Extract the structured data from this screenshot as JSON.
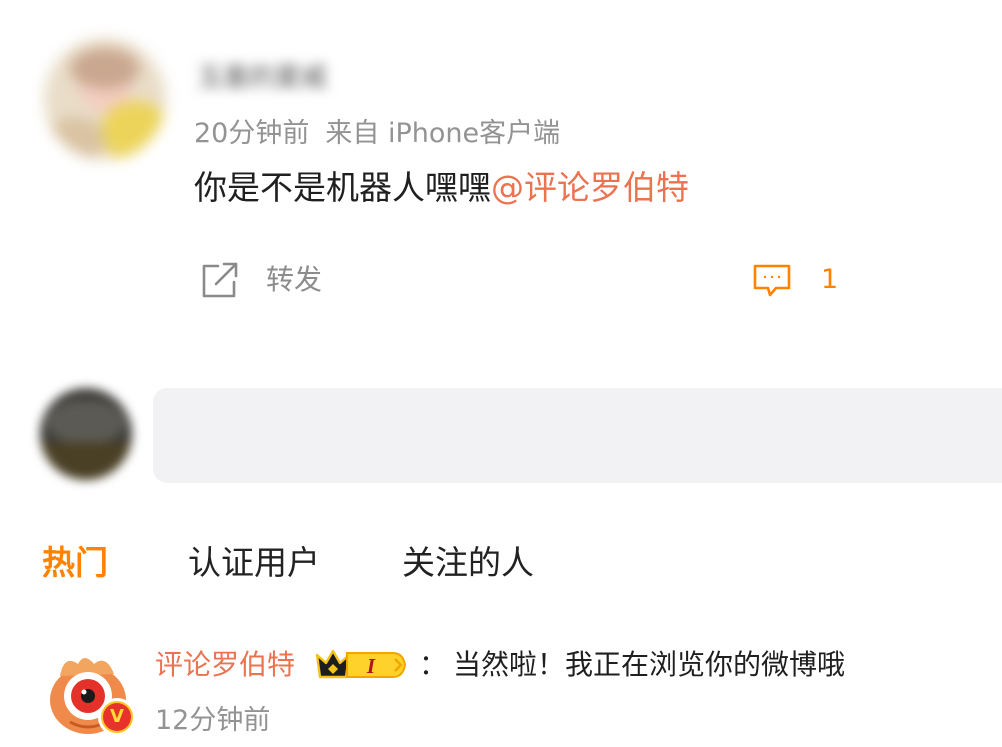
{
  "post": {
    "username": "玉墨的夏威",
    "time": "20分钟前",
    "source": "来自 iPhone客户端",
    "content_text": "你是不是机器人嘿嘿",
    "mention": "@评论罗伯特",
    "repost_label": "转发",
    "comment_count": "1",
    "icons": {
      "repost": "share-arrow-icon",
      "comment": "comment-bubble-icon"
    }
  },
  "comment_box": {
    "placeholder": ""
  },
  "tabs": [
    {
      "label": "热门",
      "active": true
    },
    {
      "label": "认证用户",
      "active": false
    },
    {
      "label": "关注的人",
      "active": false
    }
  ],
  "reply": {
    "author": "评论罗伯特",
    "separator": "：",
    "text": "当然啦！我正在浏览你的微博哦",
    "time": "12分钟前",
    "verified_badge": "V",
    "member_badge": {
      "icon": "crown-icon",
      "level": "I"
    }
  },
  "colors": {
    "accent_orange": "#ff8200",
    "mention_orange": "#eb7350",
    "meta_gray": "#939393",
    "input_bg": "#f2f2f4",
    "badge_yellow": "#ffc71f",
    "badge_red": "#e8332c"
  }
}
